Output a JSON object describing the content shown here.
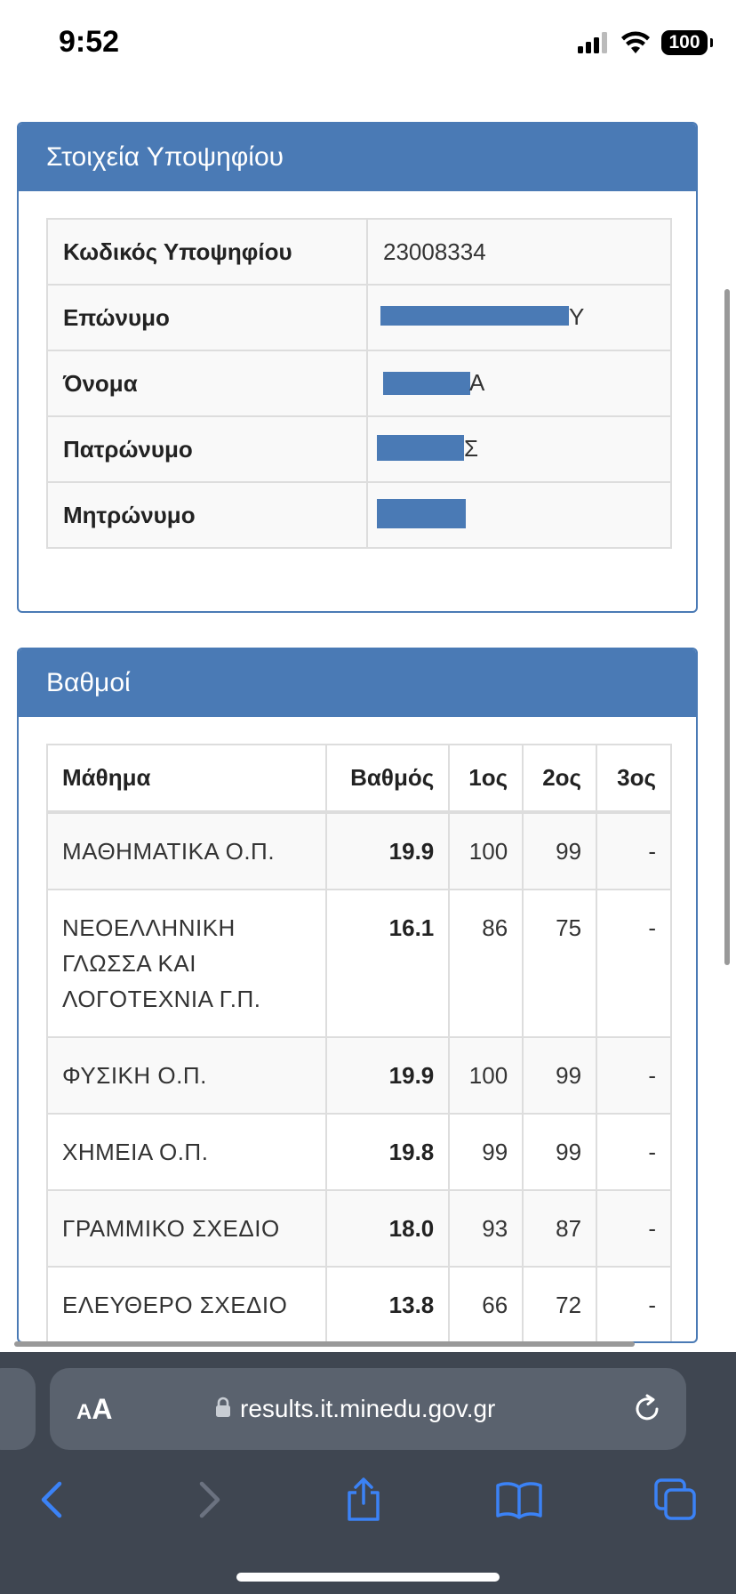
{
  "status_bar": {
    "time": "9:52",
    "battery": "100"
  },
  "candidate_panel": {
    "title": "Στοιχεία Υποψηφίου",
    "rows": [
      {
        "label": "Κωδικός Υποψηφίου",
        "value": "23008334"
      },
      {
        "label": "Επώνυμο",
        "value": "Υ"
      },
      {
        "label": "Όνομα",
        "value": "Α"
      },
      {
        "label": "Πατρώνυμο",
        "value": "Σ"
      },
      {
        "label": "Μητρώνυμο",
        "value": ""
      }
    ]
  },
  "grades_panel": {
    "title": "Βαθμοί",
    "headers": {
      "subject": "Μάθημα",
      "grade": "Βαθμός",
      "first": "1ος",
      "second": "2ος",
      "third": "3ος"
    },
    "rows": [
      {
        "subject": "ΜΑΘΗΜΑΤΙΚΑ Ο.Π.",
        "grade": "19.9",
        "first": "100",
        "second": "99",
        "third": "-"
      },
      {
        "subject": "ΝΕΟΕΛΛΗΝΙΚΗ ΓΛΩΣΣΑ ΚΑΙ ΛΟΓΟΤΕΧΝΙΑ Γ.Π.",
        "grade": "16.1",
        "first": "86",
        "second": "75",
        "third": "-"
      },
      {
        "subject": "ΦΥΣΙΚΗ Ο.Π.",
        "grade": "19.9",
        "first": "100",
        "second": "99",
        "third": "-"
      },
      {
        "subject": "ΧΗΜΕΙΑ Ο.Π.",
        "grade": "19.8",
        "first": "99",
        "second": "99",
        "third": "-"
      },
      {
        "subject": "ΓΡΑΜΜΙΚΟ ΣΧΕΔΙΟ",
        "grade": "18.0",
        "first": "93",
        "second": "87",
        "third": "-"
      },
      {
        "subject": "ΕΛΕΥΘΕΡΟ ΣΧΕΔΙΟ",
        "grade": "13.8",
        "first": "66",
        "second": "72",
        "third": "-"
      }
    ]
  },
  "browser": {
    "text_size_label_small": "A",
    "text_size_label_big": "A",
    "url": "results.it.minedu.gov.gr"
  },
  "colors": {
    "panel_accent": "#4a7ab5",
    "toolbar_accent": "#3b82f6",
    "browser_bar": "#3f4651"
  }
}
